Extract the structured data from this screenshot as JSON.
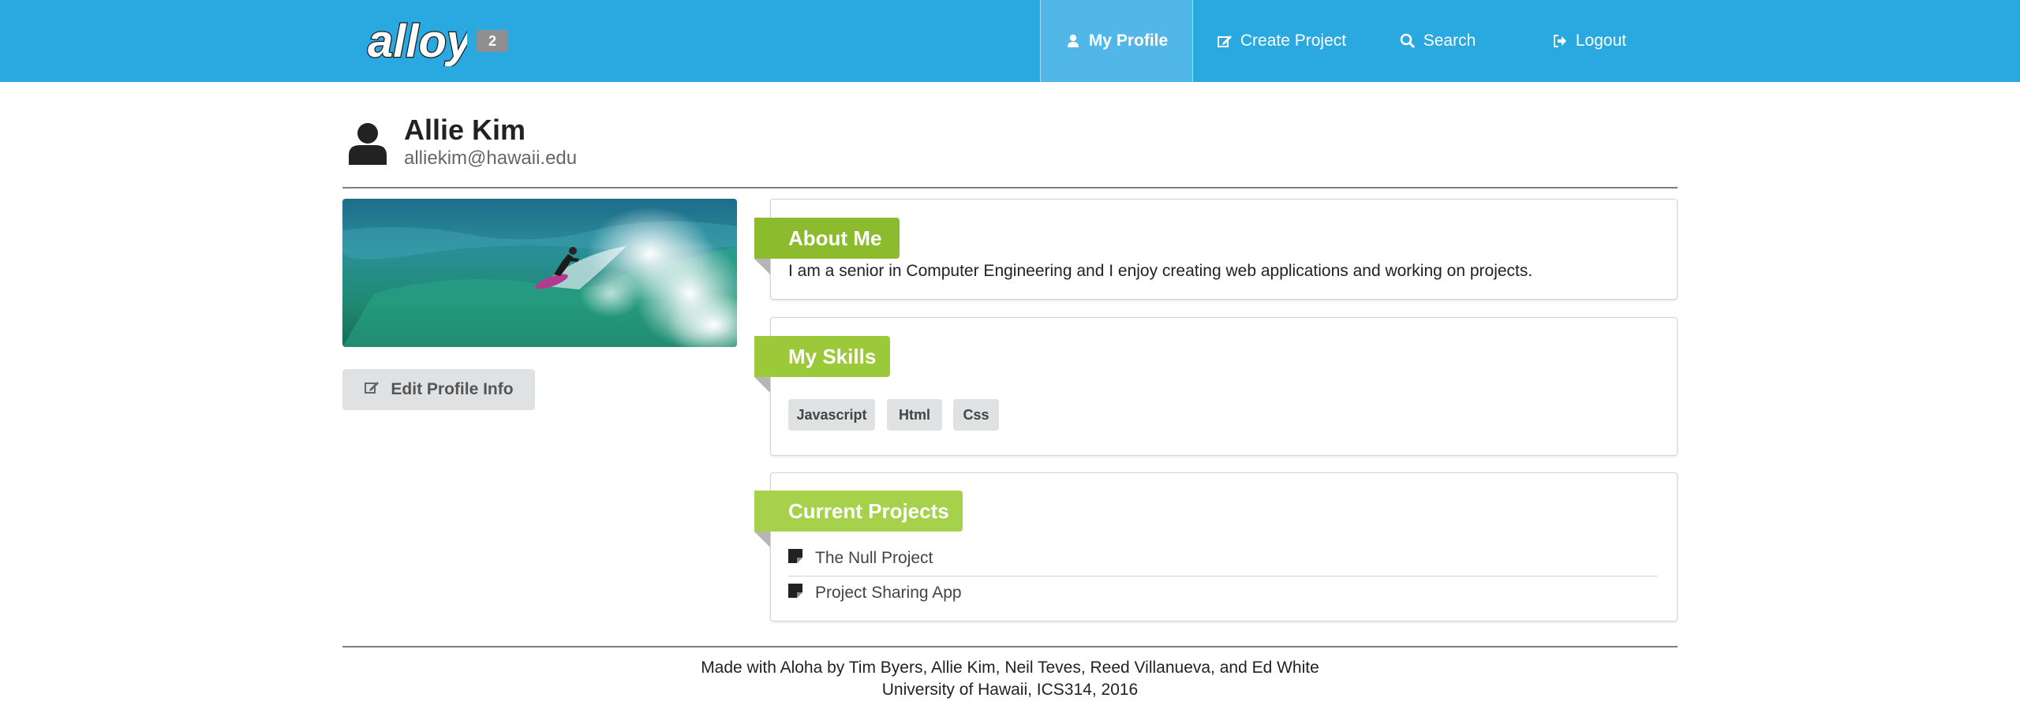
{
  "header": {
    "logo_text": "alloy",
    "badge": "2",
    "nav": [
      {
        "label": "My Profile",
        "icon": "user-icon",
        "active": true
      },
      {
        "label": "Create Project",
        "icon": "edit-icon",
        "active": false
      },
      {
        "label": "Search",
        "icon": "search-icon",
        "active": false
      },
      {
        "label": "Logout",
        "icon": "sign-out-icon",
        "active": false
      }
    ]
  },
  "profile": {
    "name": "Allie Kim",
    "email": "alliekim@hawaii.edu",
    "photo_description": "surfer-on-wave",
    "edit_label": "Edit Profile Info"
  },
  "about": {
    "title": "About Me",
    "text": "I am a senior in Computer Engineering and I enjoy creating web applications and working on projects."
  },
  "skills": {
    "title": "My Skills",
    "items": [
      "Javascript",
      "Html",
      "Css"
    ]
  },
  "projects": {
    "title": "Current Projects",
    "items": [
      "The Null Project",
      "Project Sharing App"
    ]
  },
  "footer": {
    "line1": "Made with Aloha by Tim Byers, Allie Kim, Neil Teves, Reed Villanueva, and Ed White",
    "line2": "University of Hawaii, ICS314, 2016"
  },
  "colors": {
    "topbar": "#2aa8e0",
    "ribbon_about": "#8dbb2e",
    "ribbon_skills": "#9cc93a",
    "ribbon_projects": "#a6d14a"
  }
}
